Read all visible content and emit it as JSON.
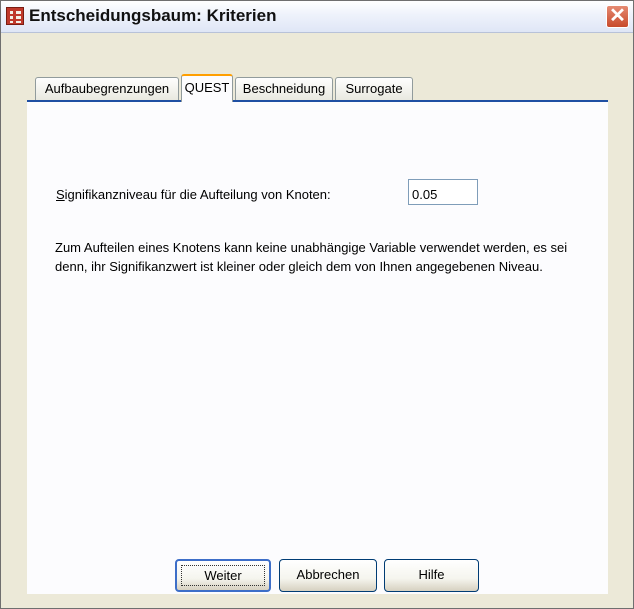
{
  "window": {
    "title": "Entscheidungsbaum: Kriterien",
    "close_glyph": "✕"
  },
  "tabs": [
    {
      "label": "Aufbaubegrenzungen",
      "active": false
    },
    {
      "label": "QUEST",
      "active": true
    },
    {
      "label": "Beschneidung",
      "active": false
    },
    {
      "label": "Surrogate",
      "active": false
    }
  ],
  "significance": {
    "label_mnemonic": "S",
    "label_rest": "ignifikanzniveau für die Aufteilung von Knoten:",
    "value": "0.05"
  },
  "description": "Zum Aufteilen eines Knotens kann keine unabhängige Variable verwendet werden, es sei denn, ihr Signifikanzwert ist kleiner oder gleich dem von Ihnen angegebenen Niveau.",
  "buttons": {
    "continue": "Weiter",
    "cancel": "Abbrechen",
    "help": "Hilfe"
  },
  "colors": {
    "dialog_bg": "#ece9d8",
    "active_tab_accent": "#ff9f00",
    "tab_line": "#1f4fa3",
    "close_button": "#c84a2b"
  }
}
